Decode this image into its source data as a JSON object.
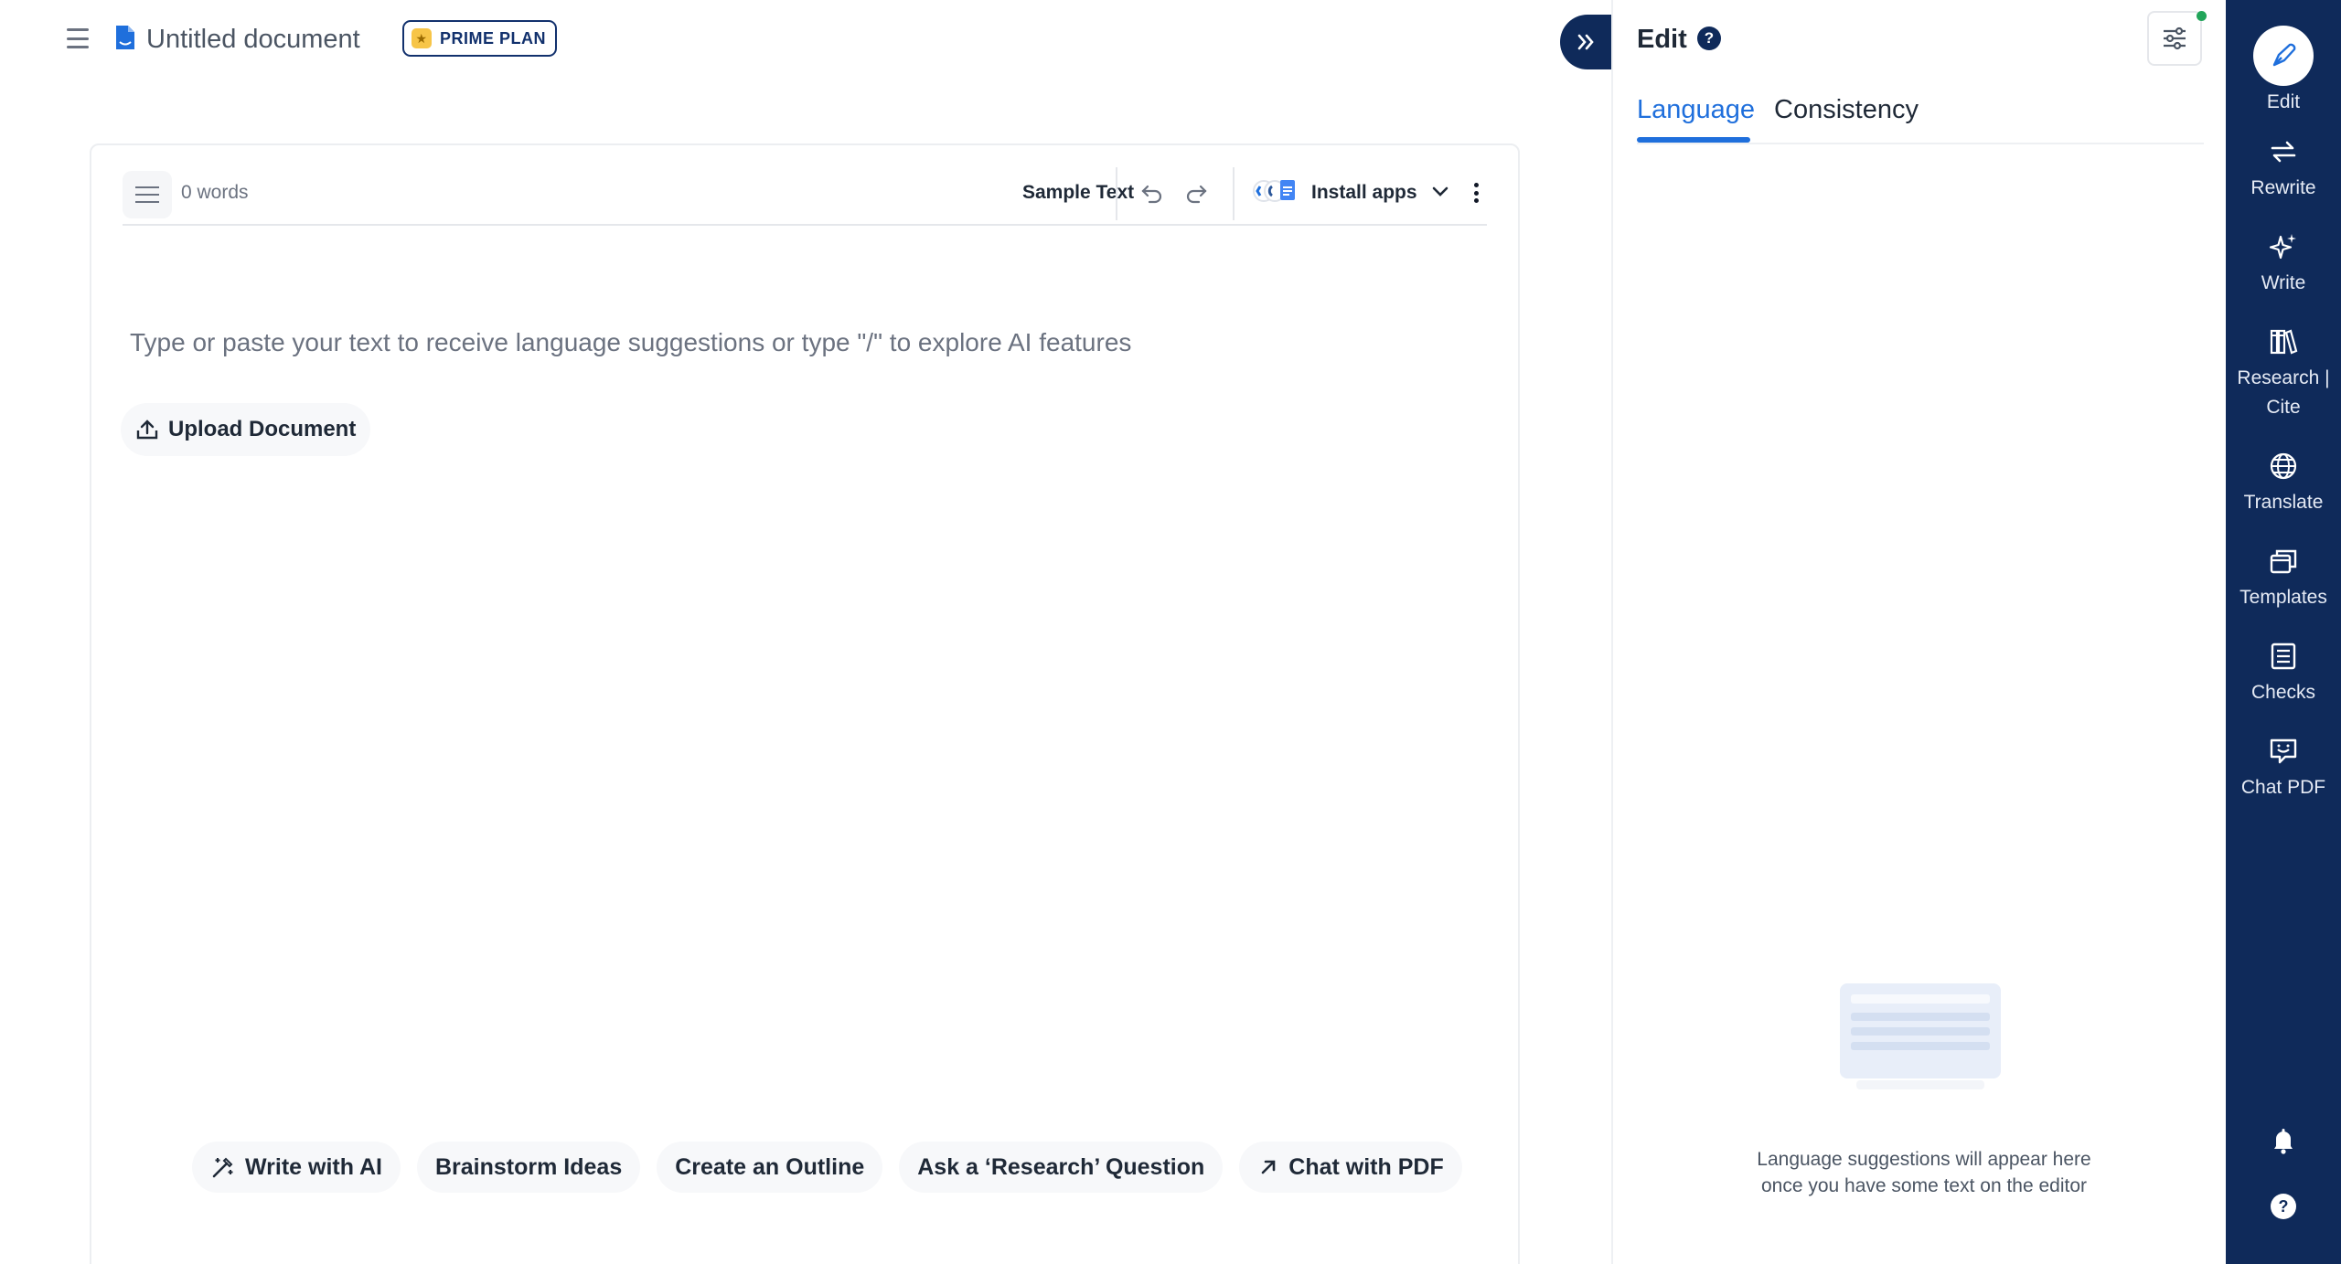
{
  "header": {
    "doc_title": "Untitled document",
    "plan_badge": "PRIME PLAN",
    "menu_icon": "hamburger-menu-icon",
    "doc_icon": "document-icon"
  },
  "editor": {
    "word_count": "0 words",
    "sample_text": "Sample Text",
    "install_apps": "Install apps",
    "placeholder": "Type or paste your text to receive language suggestions or type \"/\" to explore AI features",
    "upload_label": "Upload Document",
    "quick_actions": [
      {
        "label": "Write with AI",
        "icon": "magic-wand-icon"
      },
      {
        "label": "Brainstorm Ideas"
      },
      {
        "label": "Create an Outline"
      },
      {
        "label": "Ask a ‘Research’ Question"
      },
      {
        "label": "Chat with PDF",
        "icon": "arrow-up-right-icon"
      }
    ]
  },
  "panel": {
    "title": "Edit",
    "help": "?",
    "tabs": [
      {
        "label": "Language",
        "active": true
      },
      {
        "label": "Consistency",
        "active": false
      }
    ],
    "empty_text_line1": "Language suggestions will appear here",
    "empty_text_line2": "once you have some text on the editor"
  },
  "sidebar": {
    "items": [
      {
        "label": "Edit",
        "icon": "pen-nib-icon",
        "active": true
      },
      {
        "label": "Rewrite",
        "icon": "rewrite-arrows-icon"
      },
      {
        "label": "Write",
        "icon": "sparkle-icon"
      },
      {
        "label": "Research |",
        "label2": "Cite",
        "icon": "books-icon"
      },
      {
        "label": "Translate",
        "icon": "globe-icon"
      },
      {
        "label": "Templates",
        "icon": "templates-icon"
      },
      {
        "label": "Checks",
        "icon": "checklist-icon"
      },
      {
        "label": "Chat PDF",
        "icon": "chat-bubble-icon"
      }
    ],
    "bottom": [
      "bell-icon",
      "help-circle-icon"
    ]
  },
  "colors": {
    "brand_navy": "#0f2a5a",
    "accent_blue": "#1f6fdc",
    "badge_gold": "#f7c548",
    "status_green": "#22a55a"
  }
}
